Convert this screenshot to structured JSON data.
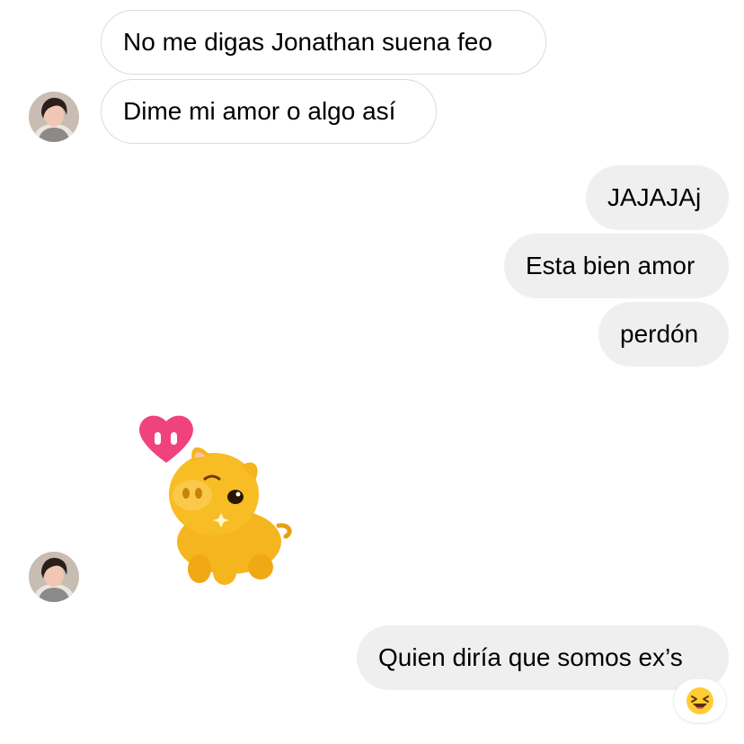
{
  "messages": [
    {
      "id": "m1",
      "direction": "incoming",
      "text": "No me digas Jonathan suena feo"
    },
    {
      "id": "m2",
      "direction": "incoming",
      "text": "Dime mi amor o algo así"
    },
    {
      "id": "m3",
      "direction": "outgoing",
      "text": "JAJAJAj"
    },
    {
      "id": "m4",
      "direction": "outgoing",
      "text": "Esta bien amor"
    },
    {
      "id": "m5",
      "direction": "outgoing",
      "text": "perdón"
    },
    {
      "id": "m6",
      "direction": "incoming",
      "type": "sticker",
      "sticker": "pig-with-heart-sticker"
    },
    {
      "id": "m7",
      "direction": "outgoing",
      "text": "Quien diría que somos ex’s",
      "reaction": "laughing-face-emoji"
    }
  ],
  "colors": {
    "incoming_bubble": "#ffffff",
    "incoming_border": "#dbdbdb",
    "outgoing_bubble": "#efefef",
    "text": "#000000",
    "heart": "#f0437e",
    "pig": "#f5b51e"
  }
}
